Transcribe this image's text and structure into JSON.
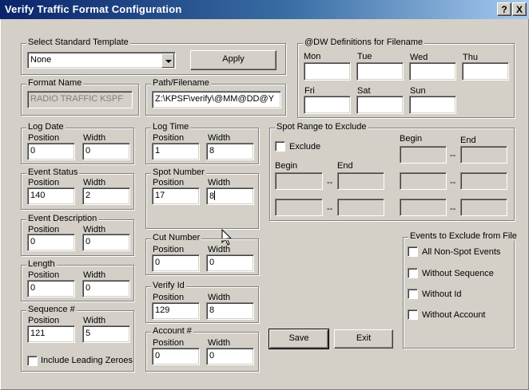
{
  "window": {
    "title": "Verify Traffic Format Configuration",
    "help_label": "?",
    "close_label": "X"
  },
  "template": {
    "legend": "Select Standard Template",
    "selected": "None",
    "apply_label": "Apply"
  },
  "dw_definitions": {
    "legend": "@DW Definitions for Filename",
    "days": [
      "Mon",
      "Tue",
      "Wed",
      "Thu",
      "Fri",
      "Sat",
      "Sun"
    ],
    "values": [
      "",
      "",
      "",
      "",
      "",
      "",
      ""
    ]
  },
  "format_name": {
    "legend": "Format Name",
    "value": "RADIO TRAFFIC KSPF"
  },
  "path_filename": {
    "legend": "Path/Filename",
    "value": "Z:\\KPSF\\verify\\@MM@DD@Y"
  },
  "labels": {
    "position": "Position",
    "width": "Width"
  },
  "fields": {
    "log_date": {
      "legend": "Log Date",
      "position": "0",
      "width": "0"
    },
    "event_status": {
      "legend": "Event Status",
      "position": "140",
      "width": "2"
    },
    "event_description": {
      "legend": "Event Description",
      "position": "0",
      "width": "0"
    },
    "length": {
      "legend": "Length",
      "position": "0",
      "width": "0"
    },
    "sequence": {
      "legend": "Sequence #",
      "position": "121",
      "width": "5",
      "leading_zeroes_label": "Include Leading Zeroes",
      "leading_zeroes_checked": false
    },
    "log_time": {
      "legend": "Log Time",
      "position": "1",
      "width": "8"
    },
    "spot_number": {
      "legend": "Spot Number",
      "position": "17",
      "width": "8"
    },
    "cut_number": {
      "legend": "Cut Number",
      "position": "0",
      "width": "0"
    },
    "verify_id": {
      "legend": "Verify Id",
      "position": "129",
      "width": "8"
    },
    "account": {
      "legend": "Account #",
      "position": "0",
      "width": "0"
    }
  },
  "spot_range": {
    "legend": "Spot Range to Exclude",
    "exclude_label": "Exclude",
    "exclude_checked": false,
    "begin_label": "Begin",
    "end_label": "End",
    "separator": "--"
  },
  "events_exclude": {
    "legend": "Events to Exclude from File",
    "items": [
      {
        "label": "All Non-Spot Events",
        "checked": false
      },
      {
        "label": "Without Sequence",
        "checked": false
      },
      {
        "label": "Without Id",
        "checked": false
      },
      {
        "label": "Without Account",
        "checked": false
      }
    ]
  },
  "actions": {
    "save_label": "Save",
    "exit_label": "Exit"
  }
}
